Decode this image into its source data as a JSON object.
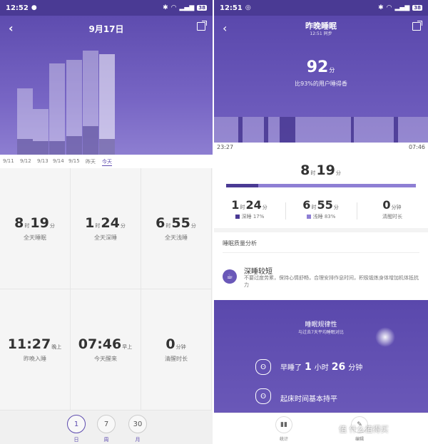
{
  "left": {
    "status": {
      "time": "12:52",
      "battery": "38"
    },
    "header": {
      "title": "9月17日"
    },
    "dates": [
      "9/11",
      "9/12",
      "9/13",
      "9/14",
      "9/15",
      "昨天",
      "今天"
    ],
    "chart_data": {
      "type": "bar",
      "categories": [
        "9/13",
        "9/14",
        "9/15",
        "9/16",
        "昨天",
        "今天"
      ],
      "series": [
        {
          "values": [
            0.58,
            0.4,
            0.8,
            0.83,
            0.91,
            0.88
          ]
        },
        {
          "values": [
            0.14,
            0.12,
            0.12,
            0.16,
            0.25,
            0.14
          ]
        }
      ]
    },
    "cells": [
      {
        "h": "8",
        "hu": "时",
        "m": "19",
        "mu": "分",
        "cap": "全天睡眠"
      },
      {
        "h": "1",
        "hu": "时",
        "m": "24",
        "mu": "分",
        "cap": "全天深睡"
      },
      {
        "h": "6",
        "hu": "时",
        "m": "55",
        "mu": "分",
        "cap": "全天浅睡"
      },
      {
        "h": "11:27",
        "hu": "",
        "m": "",
        "mu": "晚上",
        "cap": "昨晚入睡"
      },
      {
        "h": "07:46",
        "hu": "",
        "m": "",
        "mu": "早上",
        "cap": "今天醒来"
      },
      {
        "h": "0",
        "hu": "",
        "m": "",
        "mu": "分钟",
        "cap": "清醒时长"
      }
    ],
    "tabs": [
      {
        "num": "1",
        "label": "日"
      },
      {
        "num": "7",
        "label": "周"
      },
      {
        "num": "30",
        "label": "月"
      }
    ]
  },
  "right": {
    "status": {
      "time": "12:51",
      "battery": "38"
    },
    "header": {
      "title": "昨晚睡眠",
      "subtitle": "12:51 同步"
    },
    "score": {
      "value": "92",
      "unit": "分",
      "sub": "比93%的用户睡得香"
    },
    "timeline": {
      "start": "23:27",
      "end": "07:46"
    },
    "total": {
      "h": "8",
      "hu": "时",
      "m": "19",
      "mu": "分"
    },
    "deep_fraction": 0.17,
    "stats": [
      {
        "h": "1",
        "hu": "时",
        "m": "24",
        "mu": "分",
        "label": "深睡",
        "pct": "17%",
        "color": "#4a3a94"
      },
      {
        "h": "6",
        "hu": "时",
        "m": "55",
        "mu": "分",
        "label": "浅睡",
        "pct": "83%",
        "color": "#8e7fd4"
      },
      {
        "h": "0",
        "hu": "",
        "m": "",
        "mu": "分钟",
        "label": "清醒时长",
        "pct": "",
        "color": ""
      }
    ],
    "quality": {
      "title": "睡眠质量分析",
      "head": "深睡较短",
      "desc": "不要过度劳累，保持心情舒畅，合理安排作息时间，积极锻炼身体增加机体抵抗力"
    },
    "law": {
      "title": "睡眠规律性",
      "sub": "与过去7天平均睡眠对比",
      "line1_pre": "早睡了",
      "line1_h": "1",
      "line1_hu": "小时",
      "line1_m": "26",
      "line1_mu": "分钟",
      "line2": "起床时间基本持平"
    },
    "nav": [
      {
        "label": "统计"
      },
      {
        "label": "编辑"
      }
    ],
    "watermark": "值 什么值得买"
  }
}
